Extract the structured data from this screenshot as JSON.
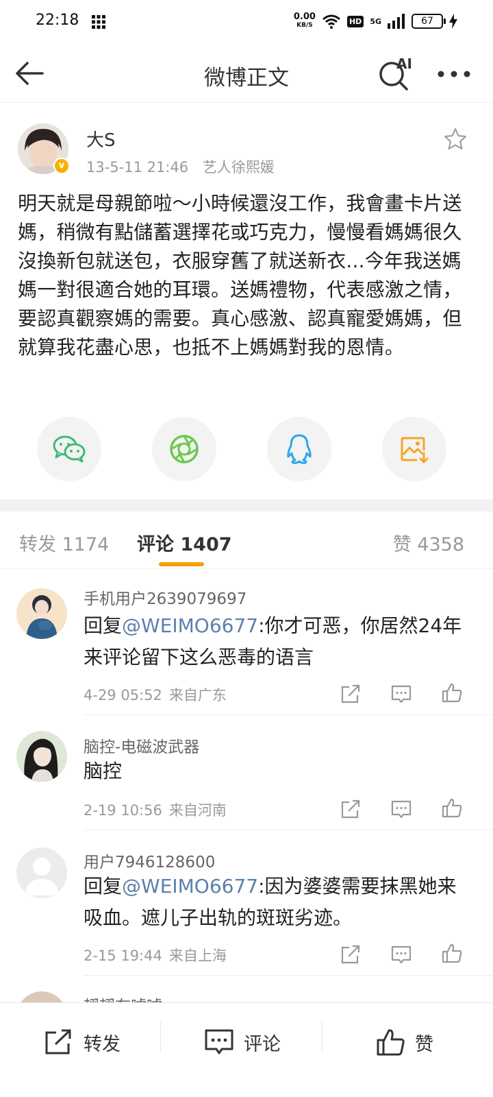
{
  "status_bar": {
    "time": "22:18",
    "net_speed": "0.00",
    "net_unit": "KB/S",
    "hd": "HD",
    "network": "5G",
    "battery": "67"
  },
  "nav": {
    "title": "微博正文",
    "ai_label": "AI"
  },
  "post": {
    "author": "大S",
    "verified": "v",
    "date": "13-5-11 21:46",
    "source": "艺人徐熙媛",
    "body": "明天就是母親節啦〜小時候還沒工作，我會畫卡片送媽，稍微有點儲蓄選擇花或巧克力，慢慢看媽媽很久沒換新包就送包，衣服穿舊了就送新衣...今年我送媽媽一對很適合她的耳環。送媽禮物，代表感激之情，要認真觀察媽的需要。真心感激、認真寵愛媽媽，但就算我花盡心思，也抵不上媽媽對我的恩情。"
  },
  "share_icons": [
    "wechat-icon",
    "moments-icon",
    "qq-icon",
    "save-image-icon"
  ],
  "tabs": {
    "repost": "转发 1174",
    "comment": "评论 1407",
    "like": "赞 4358"
  },
  "comments": [
    {
      "user": "手机用户2639079697",
      "prefix": "回复",
      "mention": "@WEIMO6677",
      "text": ":你才可恶，你居然24年来评论留下这么恶毒的语言",
      "date": "4-29 05:52",
      "location": "来自广东"
    },
    {
      "user": "脑控-电磁波武器",
      "prefix": "",
      "mention": "",
      "text": "脑控",
      "date": "2-19 10:56",
      "location": "来自河南"
    },
    {
      "user": "用户7946128600",
      "prefix": "回复",
      "mention": "@WEIMO6677",
      "text": ":因为婆婆需要抹黑她来吸血。遮儿子出轨的斑斑劣迹。",
      "date": "2-15 19:44",
      "location": "来自上海"
    },
    {
      "user": "翅翅在嘘嘘"
    }
  ],
  "bottom_bar": {
    "repost": "转发",
    "comment": "评论",
    "like": "赞"
  },
  "colors": {
    "accent": "#f59f00",
    "mention": "#5b7fab",
    "wechat": "#3fba76",
    "moments": "#6cc84d",
    "qq": "#29a8e6",
    "save": "#f5a623"
  }
}
